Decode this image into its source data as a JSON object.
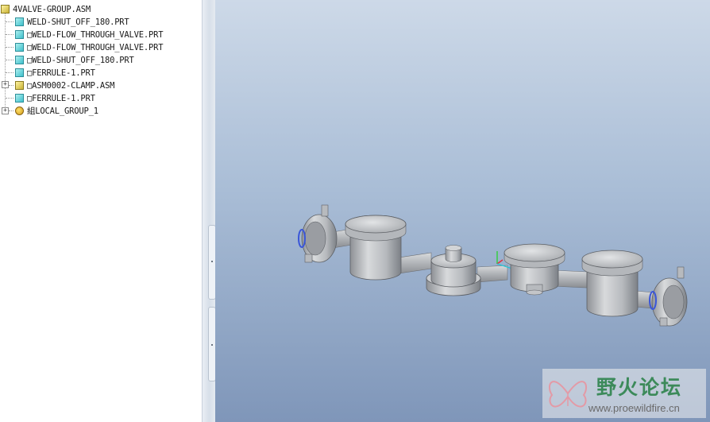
{
  "model_tree": {
    "root": {
      "label": "4VALVE-GROUP.ASM",
      "icon": "assembly-icon"
    },
    "items": [
      {
        "label": "WELD-SHUT_OFF_180.PRT",
        "icon": "part-icon"
      },
      {
        "label": "□WELD-FLOW_THROUGH_VALVE.PRT",
        "icon": "part-icon"
      },
      {
        "label": "□WELD-FLOW_THROUGH_VALVE.PRT",
        "icon": "part-icon"
      },
      {
        "label": "□WELD-SHUT_OFF_180.PRT",
        "icon": "part-icon"
      },
      {
        "label": "□FERRULE-1.PRT",
        "icon": "part-icon"
      },
      {
        "label": "□ASM0002-CLAMP.ASM",
        "icon": "assembly-icon",
        "expandable": true
      },
      {
        "label": "□FERRULE-1.PRT",
        "icon": "part-icon"
      },
      {
        "label": "組LOCAL_GROUP_1",
        "icon": "group-icon",
        "expandable": true
      }
    ]
  },
  "watermark": {
    "title": "野火论坛",
    "url": "www.proewildfire.cn"
  },
  "colors": {
    "viewport_top": "#cdd9e8",
    "viewport_bottom": "#7f96b9",
    "model_gray": "#c4c6c9"
  }
}
